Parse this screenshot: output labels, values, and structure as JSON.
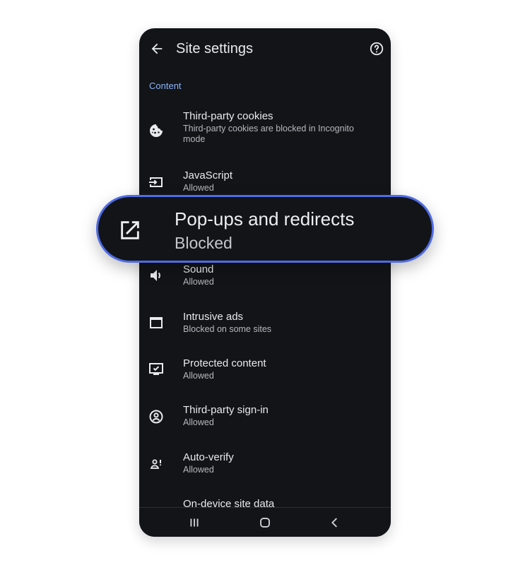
{
  "app": {
    "title": "Site settings"
  },
  "section": {
    "label": "Content"
  },
  "items": [
    {
      "title": "Third-party cookies",
      "subtitle": "Third-party cookies are blocked in Incognito mode",
      "icon": "cookie-icon"
    },
    {
      "title": "JavaScript",
      "subtitle": "Allowed",
      "icon": "javascript-icon"
    },
    {
      "title": "Sound",
      "subtitle": "Allowed",
      "icon": "sound-icon"
    },
    {
      "title": "Intrusive ads",
      "subtitle": "Blocked on some sites",
      "icon": "ads-icon"
    },
    {
      "title": "Protected content",
      "subtitle": "Allowed",
      "icon": "protected-content-icon"
    },
    {
      "title": "Third-party sign-in",
      "subtitle": "Allowed",
      "icon": "sign-in-icon"
    },
    {
      "title": "Auto-verify",
      "subtitle": "Allowed",
      "icon": "auto-verify-icon"
    },
    {
      "title": "On-device site data",
      "subtitle": "",
      "icon": "site-data-icon"
    }
  ],
  "highlight": {
    "title": "Pop-ups and redirects",
    "subtitle": "Blocked",
    "icon": "open-in-new-icon"
  },
  "colors": {
    "background": "#121418",
    "accent": "#8ab4f8",
    "highlight_border": "#4f6be6"
  },
  "navbar": {
    "icons": [
      "recent-apps-icon",
      "home-icon",
      "back-nav-icon"
    ]
  }
}
